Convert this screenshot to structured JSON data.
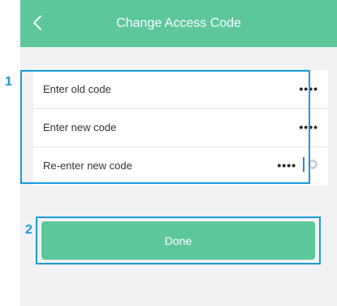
{
  "header": {
    "title": "Change Access Code",
    "back_icon": "chevron-left-icon"
  },
  "form": {
    "rows": [
      {
        "label": "Enter old code",
        "value": "••••"
      },
      {
        "label": "Enter new code",
        "value": "••••"
      },
      {
        "label": "Re-enter new code",
        "value": "••••",
        "focused": true
      }
    ],
    "clear_icon": "clear-circle-icon"
  },
  "done_button": {
    "label": "Done"
  },
  "annotations": [
    {
      "number": "1"
    },
    {
      "number": "2"
    }
  ],
  "colors": {
    "accent": "#5cc79b",
    "annotation": "#1a9ad6",
    "background": "#f2f2f4"
  }
}
